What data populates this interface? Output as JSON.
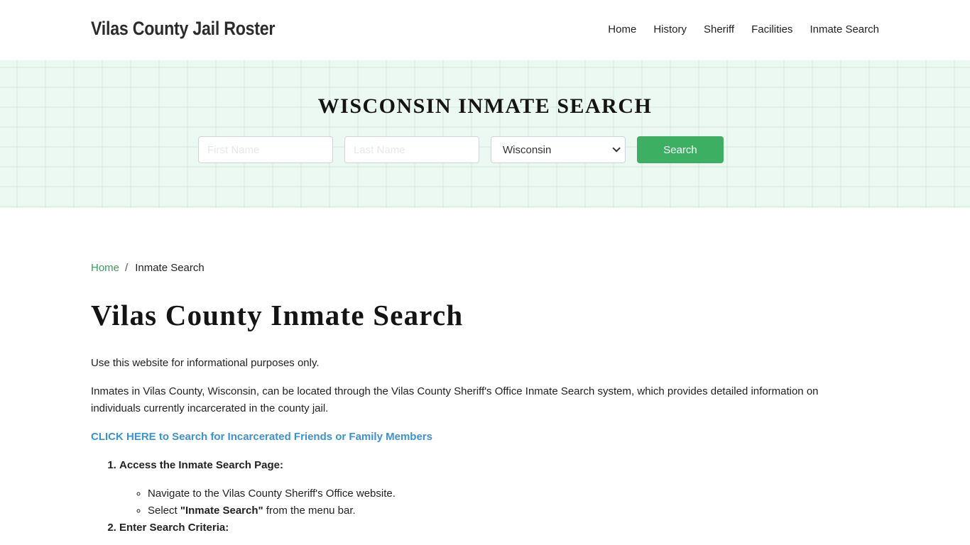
{
  "header": {
    "brand": "Vilas County Jail Roster",
    "nav": [
      "Home",
      "History",
      "Sheriff",
      "Facilities",
      "Inmate Search"
    ]
  },
  "hero": {
    "title": "WISCONSIN INMATE SEARCH",
    "first_name_placeholder": "First Name",
    "last_name_placeholder": "Last Name",
    "state_selected": "Wisconsin",
    "search_label": "Search",
    "colors": {
      "accent": "#3caf62",
      "hero_bg": "#ecf9f2"
    }
  },
  "breadcrumb": {
    "home": "Home",
    "separator": "/",
    "current": "Inmate Search"
  },
  "main": {
    "title": "Vilas County Inmate Search",
    "para1": "Use this website for informational purposes only.",
    "para2": "Inmates in Vilas County, Wisconsin, can be located through the Vilas County Sheriff's Office Inmate Search system, which provides detailed information on individuals currently incarcerated in the county jail.",
    "cta": "CLICK HERE to Search for Incarcerated Friends or Family Members",
    "steps": [
      {
        "title": "Access the Inmate Search Page:",
        "items": [
          {
            "text": "Navigate to the Vilas County Sheriff's Office website."
          },
          {
            "pre": "Select ",
            "bold": "\"Inmate Search\"",
            "post": " from the menu bar."
          }
        ]
      },
      {
        "title": "Enter Search Criteria:"
      }
    ]
  }
}
